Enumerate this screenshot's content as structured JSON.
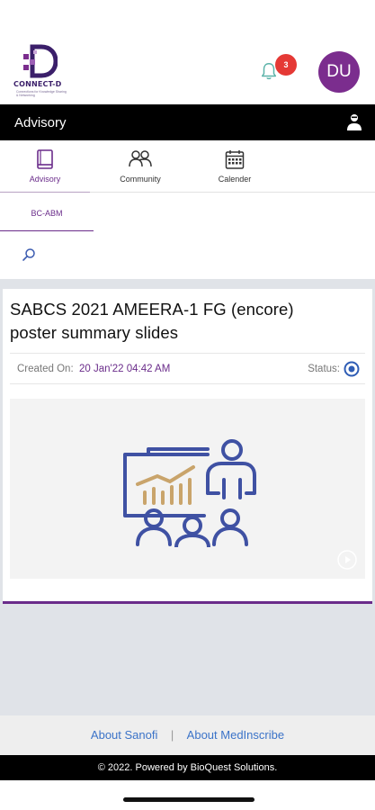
{
  "header": {
    "logo_text": "CONNECT-D",
    "logo_tagline": "Connections for Knowledge Sharing & Networking",
    "notification_count": "3",
    "avatar_initials": "DU"
  },
  "titlebar": {
    "title": "Advisory"
  },
  "tabs": [
    {
      "label": "Advisory",
      "icon": "book-icon",
      "active": true
    },
    {
      "label": "Community",
      "icon": "people-icon",
      "active": false
    },
    {
      "label": "Calender",
      "icon": "calendar-icon",
      "active": false
    }
  ],
  "subtab": {
    "label": "BC-ABM"
  },
  "card": {
    "title": "SABCS 2021 AMEERA-1 FG (encore) poster summary slides",
    "created_label": "Created On:",
    "created_value": "20 Jan'22 04:42 AM",
    "status_label": "Status:"
  },
  "footer": {
    "link1": "About Sanofi",
    "separator": "|",
    "link2": "About MedInscribe",
    "copyright": "© 2022. Powered by BioQuest Solutions."
  },
  "colors": {
    "accent": "#6a2c8a",
    "avatar": "#7b2d8e",
    "badge": "#e53935",
    "link": "#3b73c8",
    "illustration_blue": "#3f51a3",
    "illustration_gold": "#c9a46b"
  }
}
